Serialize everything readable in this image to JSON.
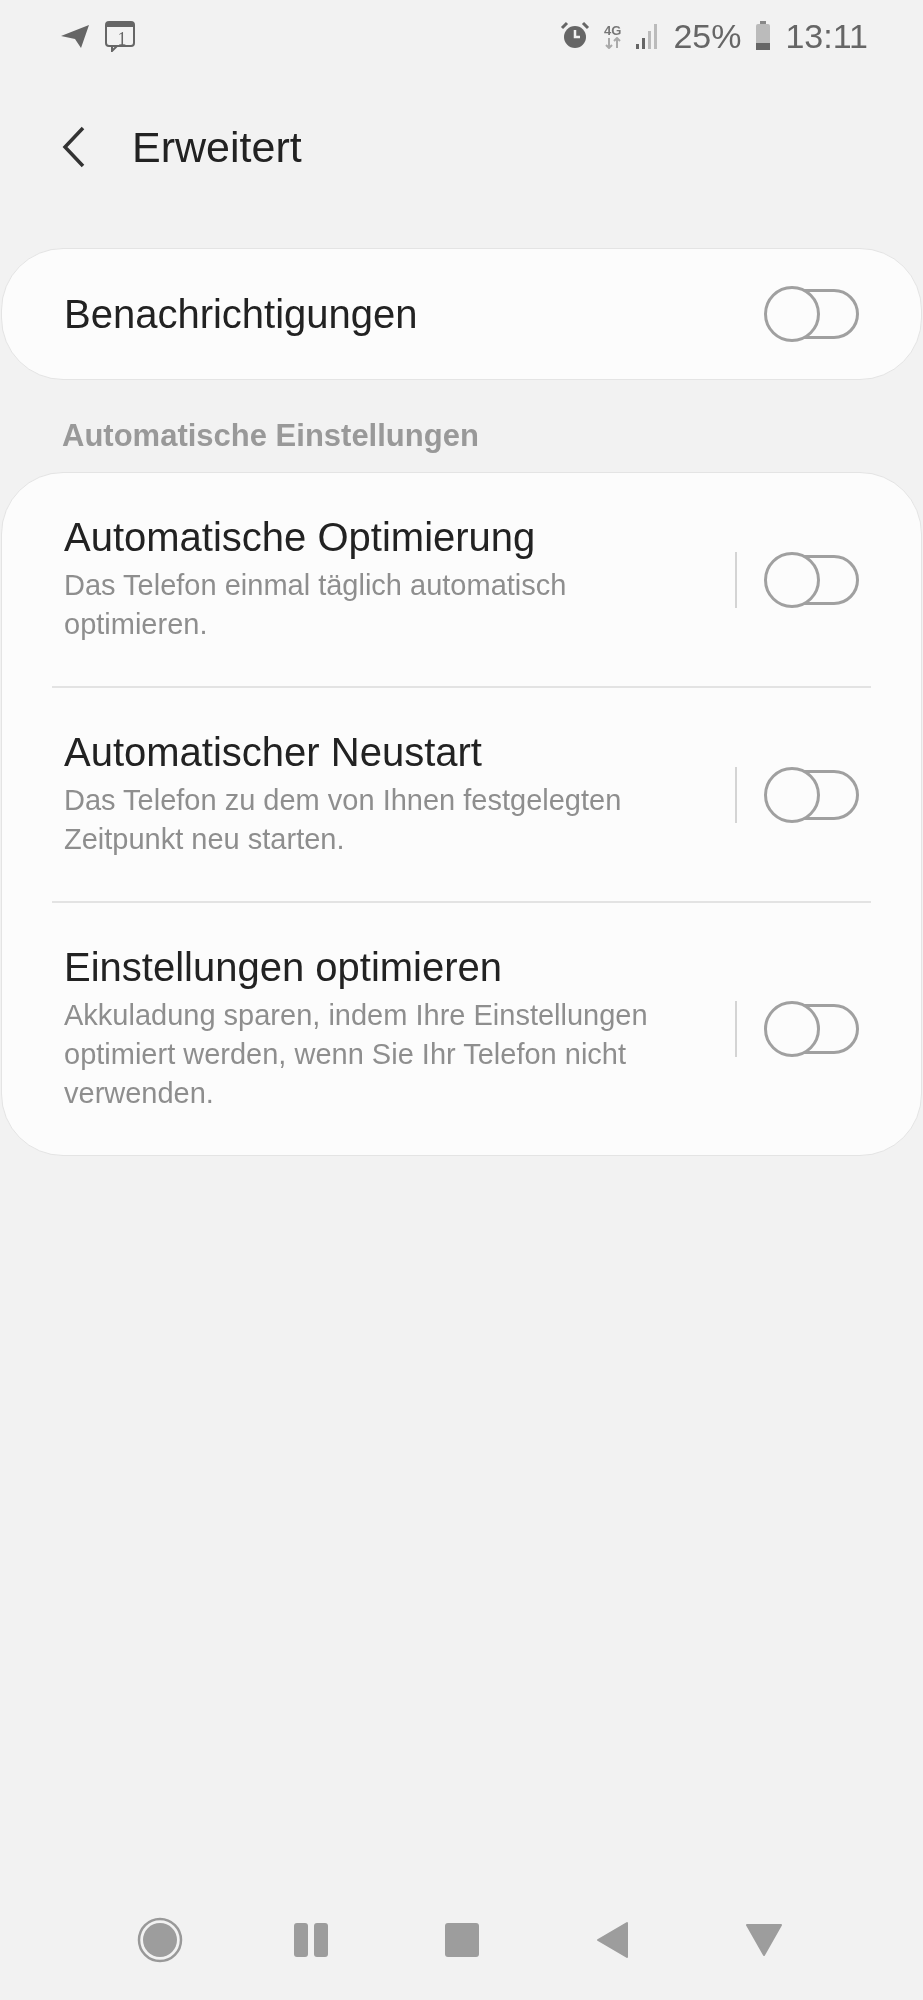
{
  "status_bar": {
    "notification_badge": "1",
    "battery": "25%",
    "time": "13:11",
    "network": "4G"
  },
  "header": {
    "title": "Erweitert"
  },
  "top_card": {
    "items": [
      {
        "title": "Benachrichtigungen",
        "on": false
      }
    ]
  },
  "section": {
    "title": "Automatische Einstellungen",
    "items": [
      {
        "title": "Automatische Optimierung",
        "description": "Das Telefon einmal täglich automatisch optimieren.",
        "on": false
      },
      {
        "title": "Automatischer Neustart",
        "description": "Das Telefon zu dem von Ihnen festgelegten Zeitpunkt neu starten.",
        "on": false
      },
      {
        "title": "Einstellungen optimieren",
        "description": "Akkuladung sparen, indem Ihre Einstellungen optimiert werden, wenn Sie Ihr Telefon nicht verwenden.",
        "on": false
      }
    ]
  }
}
